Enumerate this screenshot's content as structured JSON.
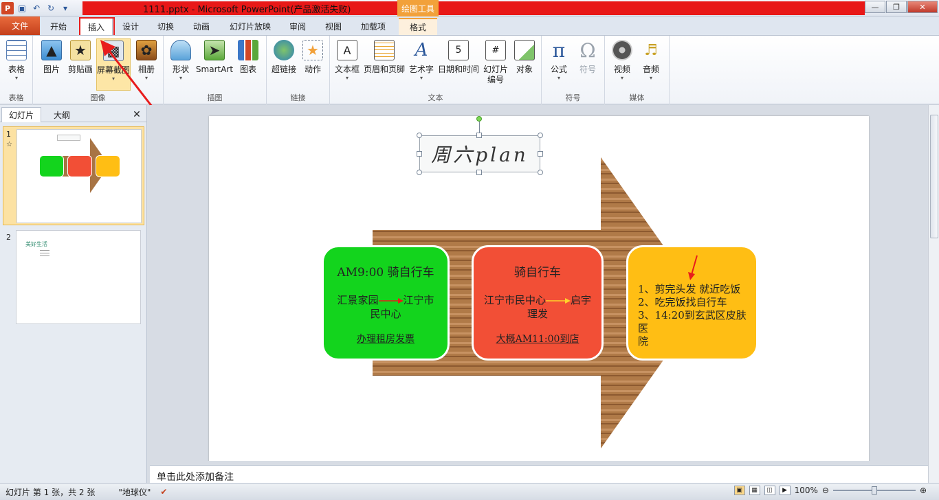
{
  "window": {
    "title": "1111.pptx - Microsoft PowerPoint(产品激活失败)",
    "tool_context": "绘图工具"
  },
  "tabs": [
    "文件",
    "开始",
    "插入",
    "设计",
    "切换",
    "动画",
    "幻灯片放映",
    "审阅",
    "视图",
    "加载项",
    "格式"
  ],
  "active_tab": "插入",
  "ribbon": {
    "groups": [
      {
        "label": "表格",
        "buttons": [
          "表格"
        ]
      },
      {
        "label": "图像",
        "buttons": [
          "图片",
          "剪贴画",
          "屏幕截图",
          "相册"
        ]
      },
      {
        "label": "插图",
        "buttons": [
          "形状",
          "SmartArt",
          "图表"
        ]
      },
      {
        "label": "链接",
        "buttons": [
          "超链接",
          "动作"
        ]
      },
      {
        "label": "文本",
        "buttons": [
          "文本框",
          "页眉和页脚",
          "艺术字",
          "日期和时间",
          "幻灯片编号",
          "对象"
        ]
      },
      {
        "label": "符号",
        "buttons": [
          "公式",
          "符号"
        ]
      },
      {
        "label": "媒体",
        "buttons": [
          "视频",
          "音频"
        ]
      }
    ],
    "slide_number_btn": [
      "幻灯片",
      "编号"
    ]
  },
  "panel": {
    "tabs": [
      "幻灯片",
      "大纲"
    ],
    "thumb1_num": "1",
    "thumb2_num": "2",
    "thumb2_title": "美好生活"
  },
  "slide": {
    "title": "周六plan",
    "card1": {
      "title": "AM9:00 骑自行车",
      "route_from": "汇景家园",
      "route_to": "江宁市",
      "route_to_2": "民中心",
      "note": "办理租房发票",
      "color": "#13d41d"
    },
    "card2": {
      "title": "骑自行车",
      "route_from": "江宁市民中心",
      "route_to": "启宇",
      "route_to_2": "理发",
      "note": "大概AM11:00到店",
      "color": "#f24f36"
    },
    "card3": {
      "items": [
        "1、剪完头发 就近吃饭",
        "2、吃完饭找自行车",
        "3、14:20到玄武区皮肤医",
        "院"
      ],
      "color": "#ffbe14"
    }
  },
  "notes_placeholder": "单击此处添加备注",
  "status": {
    "slide_info": "幻灯片 第 1 张，共 2 张",
    "theme": "\"地球仪\"",
    "zoom": "100%",
    "zoom_level": 0.5
  },
  "colors": {
    "accent_red": "#e81818",
    "file_tab": "#c4401c",
    "tool_tab": "#f2a13a"
  }
}
